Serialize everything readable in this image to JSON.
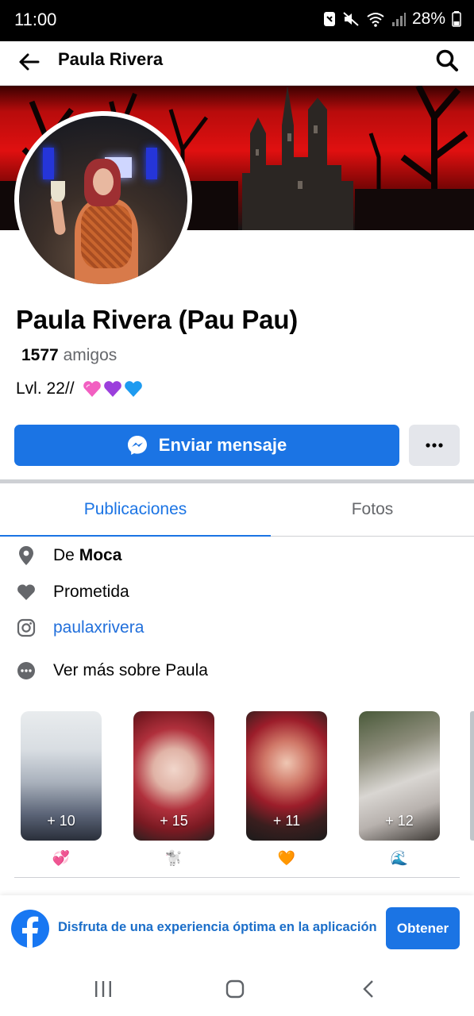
{
  "status_bar": {
    "time": "11:00",
    "battery": "28%"
  },
  "header": {
    "title": "Paula Rivera"
  },
  "profile": {
    "name": "Paula Rivera (Pau Pau)",
    "friends_count": "1577",
    "friends_label": "amigos",
    "bio": "Lvl. 22//",
    "bio_hearts": [
      "pink-heart-icon",
      "purple-heart-icon",
      "blue-heart-icon"
    ]
  },
  "actions": {
    "message_label": "Enviar mensaje",
    "more_label": "•••"
  },
  "tabs": [
    {
      "label": "Publicaciones",
      "active": true
    },
    {
      "label": "Fotos",
      "active": false
    }
  ],
  "info": {
    "location_prefix": "De",
    "location": "Moca",
    "relationship": "Prometida",
    "instagram": "paulaxrivera",
    "see_more": "Ver más sobre Paula"
  },
  "highlights": [
    {
      "count": "+ 10",
      "emoji": "💞"
    },
    {
      "count": "+ 15",
      "emoji": "🐩"
    },
    {
      "count": "+ 11",
      "emoji": "🧡"
    },
    {
      "count": "+ 12",
      "emoji": "🌊"
    }
  ],
  "app_banner": {
    "text": "Disfruta de una experiencia óptima en la aplicación",
    "button": "Obtener"
  },
  "colors": {
    "accent": "#1b74e4",
    "secondary_button": "#e4e6eb",
    "muted_text": "#65676b",
    "link": "#216fdb"
  }
}
